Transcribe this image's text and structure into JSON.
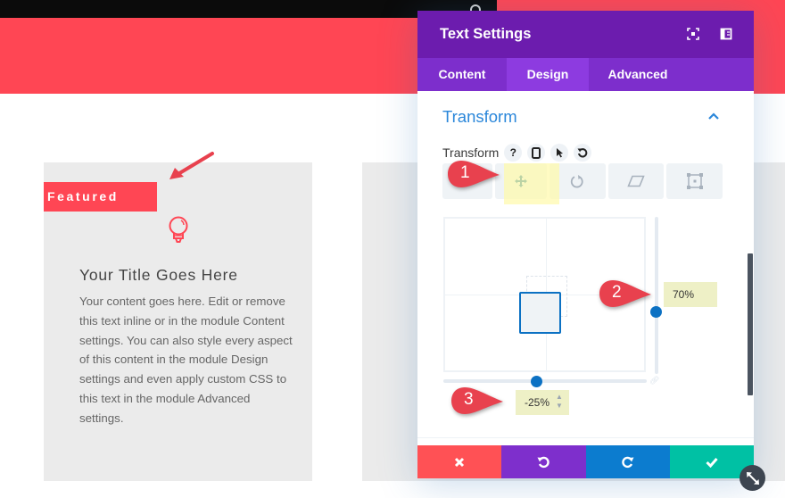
{
  "page": {
    "featured_label": "Featured",
    "card_title": "Your Title Goes Here",
    "card_body": "Your content goes here. Edit or remove this text inline or in the module Content settings. You can also style every aspect of this content in the module Design settings and even apply custom CSS to this text in the module Advanced settings.",
    "icon": "lightbulb-icon"
  },
  "colors": {
    "brand_red": "#ff4654",
    "header_purple": "#6c1cae",
    "tab_purple": "#7d2ecc",
    "tab_active": "#8d3be0",
    "accent_blue": "#2b87da",
    "knob_blue": "#0c71c3",
    "cancel": "#ff5155",
    "undo": "#7e2fcc",
    "redo": "#0c7ccf",
    "save": "#00c1a4"
  },
  "modal": {
    "title": "Text Settings",
    "header_icons": [
      "expand-icon",
      "sidebar-layout-icon"
    ],
    "tabs": [
      {
        "label": "Content",
        "active": false
      },
      {
        "label": "Design",
        "active": true
      },
      {
        "label": "Advanced",
        "active": false
      }
    ],
    "section": {
      "title": "Transform",
      "expanded": true,
      "field_label": "Transform",
      "field_icons": [
        "help-icon",
        "mobile-icon",
        "cursor-icon",
        "reset-icon"
      ],
      "modes": [
        {
          "name": "translate",
          "icon": "move-icon",
          "active": true
        },
        {
          "name": "rotate",
          "icon": "rotate-icon",
          "active": false
        },
        {
          "name": "skew",
          "icon": "skew-icon",
          "active": false
        },
        {
          "name": "origin",
          "icon": "origin-icon",
          "active": false
        }
      ],
      "translate_y": "70%",
      "translate_x": "-25%"
    },
    "footer": {
      "cancel": "close-icon",
      "undo": "undo-icon",
      "redo": "redo-icon",
      "save": "check-icon"
    }
  },
  "annotations": [
    {
      "number": "1"
    },
    {
      "number": "2"
    },
    {
      "number": "3"
    }
  ]
}
